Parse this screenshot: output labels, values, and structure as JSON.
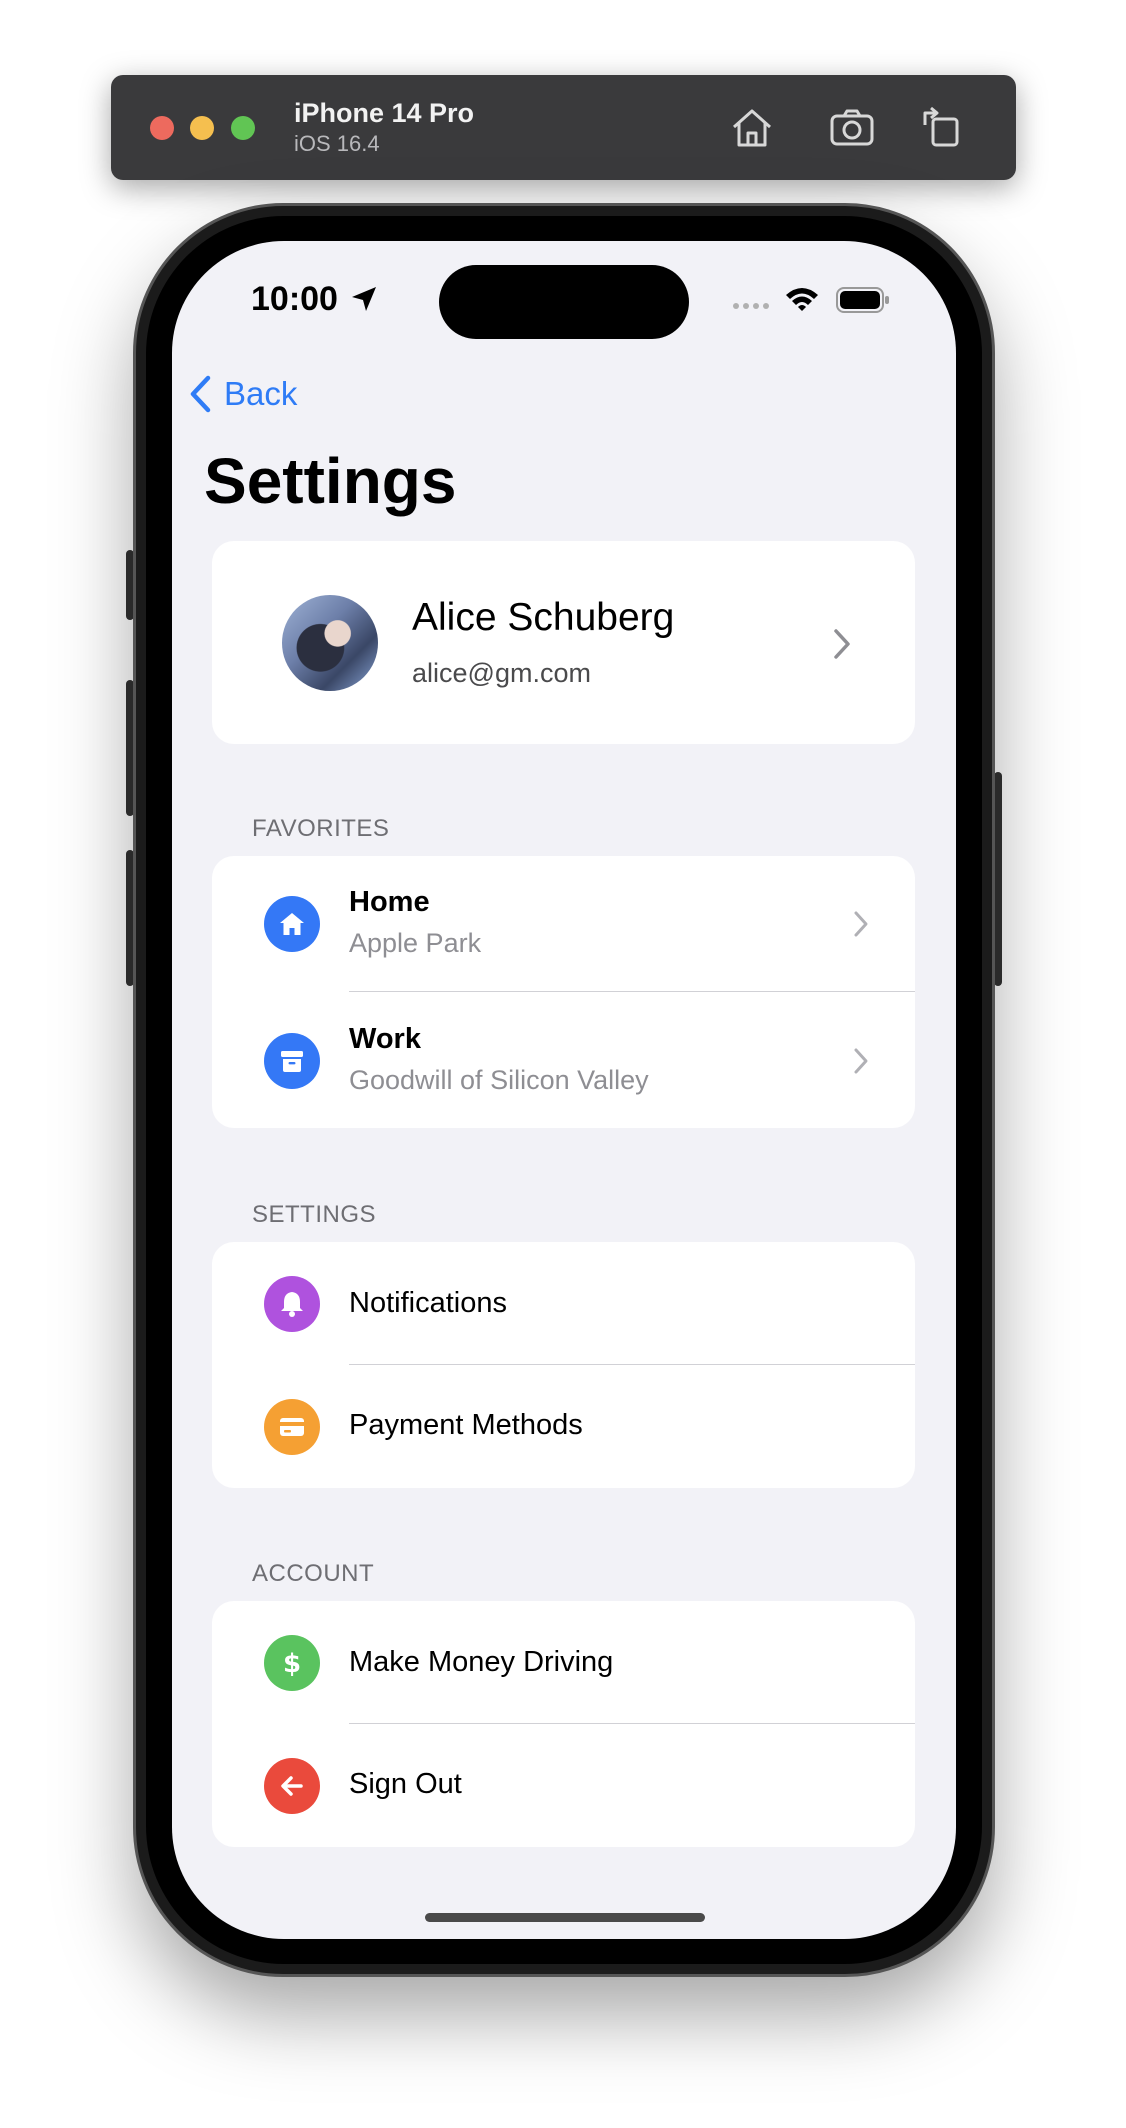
{
  "simulator": {
    "device_name": "iPhone 14 Pro",
    "os_version": "iOS 16.4",
    "icons": [
      "home-icon",
      "screenshot-icon",
      "rotate-icon"
    ]
  },
  "status_bar": {
    "time": "10:00"
  },
  "nav": {
    "back_label": "Back",
    "title": "Settings"
  },
  "profile": {
    "name": "Alice Schuberg",
    "email": "alice@gm.com"
  },
  "favorites": {
    "header": "FAVORITES",
    "items": [
      {
        "title": "Home",
        "subtitle": "Apple Park",
        "icon": "house-icon",
        "color": "#3478f6"
      },
      {
        "title": "Work",
        "subtitle": "Goodwill of Silicon Valley",
        "icon": "archivebox-icon",
        "color": "#3478f6"
      }
    ]
  },
  "settings": {
    "header": "SETTINGS",
    "items": [
      {
        "title": "Notifications",
        "icon": "bell-icon",
        "color": "#af52de"
      },
      {
        "title": "Payment Methods",
        "icon": "creditcard-icon",
        "color": "#f5a033"
      }
    ]
  },
  "account": {
    "header": "ACCOUNT",
    "items": [
      {
        "title": "Make Money Driving",
        "icon": "dollar-icon",
        "color": "#5ac35f"
      },
      {
        "title": "Sign Out",
        "icon": "arrow-left-icon",
        "color": "#ea4a3c"
      }
    ]
  }
}
